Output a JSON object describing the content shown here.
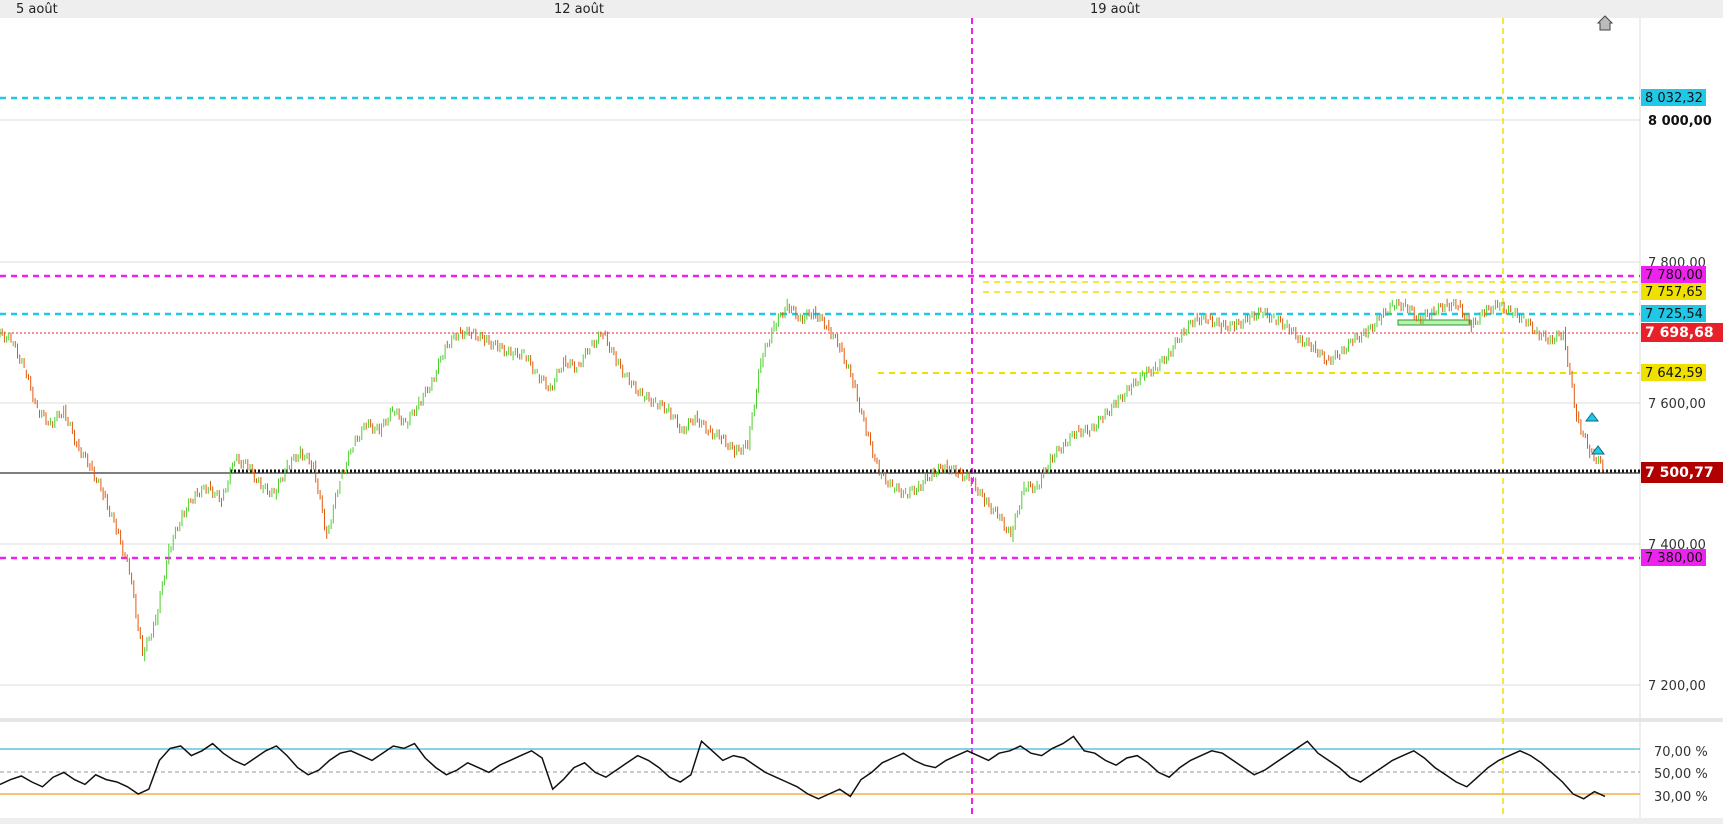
{
  "chart_data": [
    {
      "type": "line",
      "subtype": "candlestick-price",
      "x_labels": [
        "5 août",
        "12 août",
        "19 août"
      ],
      "y_ticks": [
        "8 000,00",
        "7 800,00",
        "7 600,00",
        "7 400,00",
        "7 200,00"
      ],
      "y_tick_values": [
        8000,
        7800,
        7600,
        7400,
        7200
      ],
      "ylim": [
        7150,
        8150
      ],
      "grid": true,
      "current_price": {
        "value": 7500.77,
        "label": "7 500,77",
        "color": "#b00000"
      },
      "last_close_line": {
        "value": 7698.68,
        "label": "7 698,68",
        "color": "#e8202a"
      },
      "levels": [
        {
          "value": 8032.32,
          "label": "8 032,32",
          "color": "#20c8e8",
          "style": "dashed"
        },
        {
          "value": 7780.0,
          "label": "7 780,00",
          "color": "#ee22ee",
          "style": "dashed"
        },
        {
          "value": 7757.65,
          "label": "7 757,65",
          "color": "#f0e000",
          "style": "dashed"
        },
        {
          "value": 7725.54,
          "label": "7 725,54",
          "color": "#20c8e8",
          "style": "dashed"
        },
        {
          "value": 7642.59,
          "label": "7 642,59",
          "color": "#f0e000",
          "style": "dashed"
        },
        {
          "value": 7380.0,
          "label": "7 380,00",
          "color": "#ee22ee",
          "style": "dashed"
        }
      ],
      "series": [
        {
          "values": [
            7700,
            7690,
            7650,
            7590,
            7570,
            7590,
            7540,
            7510,
            7470,
            7420,
            7360,
            7240,
            7290,
            7390,
            7440,
            7470,
            7480,
            7460,
            7520,
            7510,
            7480,
            7470,
            7510,
            7530,
            7510,
            7410,
            7490,
            7540,
            7570,
            7560,
            7590,
            7570,
            7600,
            7630,
            7680,
            7700,
            7700,
            7690,
            7680,
            7670,
            7670,
            7640,
            7620,
            7660,
            7650,
            7680,
            7700,
            7660,
            7630,
            7610,
            7600,
            7590,
            7560,
            7580,
            7560,
            7550,
            7530,
            7540,
            7660,
            7710,
            7740,
            7720,
            7730,
            7710,
            7680,
            7630,
            7560,
            7500,
            7480,
            7470,
            7480,
            7500,
            7510,
            7500,
            7490,
            7460,
            7440,
            7410,
            7480,
            7480,
            7520,
            7540,
            7560,
            7560,
            7580,
            7600,
            7620,
            7640,
            7650,
            7670,
            7700,
            7720,
            7720,
            7710,
            7710,
            7720,
            7730,
            7720,
            7710,
            7690,
            7680,
            7660,
            7670,
            7690,
            7700,
            7720,
            7740,
            7740,
            7720,
            7730,
            7740,
            7740,
            7710,
            7730,
            7740,
            7730,
            7720,
            7700,
            7690,
            7700,
            7580,
            7530,
            7510
          ]
        }
      ]
    },
    {
      "type": "line",
      "subtype": "rsi-indicator",
      "y_ticks": [
        "70,00 %",
        "50,00 %",
        "30,00 %"
      ],
      "y_tick_values": [
        70,
        50,
        30
      ],
      "ylim": [
        10,
        90
      ],
      "reference_lines": [
        {
          "value": 70,
          "color": "#40b8d8"
        },
        {
          "value": 50,
          "color": "#999999"
        },
        {
          "value": 30,
          "color": "#f0a020"
        }
      ],
      "series": [
        {
          "values": [
            38,
            42,
            45,
            40,
            36,
            44,
            48,
            42,
            38,
            46,
            42,
            40,
            36,
            30,
            34,
            58,
            68,
            70,
            62,
            66,
            72,
            64,
            58,
            54,
            60,
            66,
            70,
            62,
            52,
            46,
            50,
            58,
            64,
            66,
            62,
            58,
            64,
            70,
            68,
            72,
            60,
            52,
            46,
            50,
            56,
            52,
            48,
            54,
            58,
            62,
            66,
            60,
            34,
            42,
            52,
            56,
            48,
            44,
            50,
            56,
            62,
            58,
            52,
            44,
            40,
            46,
            74,
            66,
            58,
            62,
            60,
            54,
            48,
            44,
            40,
            36,
            30,
            26,
            30,
            34,
            28,
            42,
            48,
            56,
            60,
            64,
            58,
            54,
            52,
            58,
            62,
            66,
            62,
            58,
            64,
            66,
            70,
            64,
            62,
            68,
            72,
            78,
            66,
            64,
            58,
            54,
            60,
            62,
            56,
            48,
            44,
            52,
            58,
            62,
            66,
            64,
            58,
            52,
            46,
            50,
            56,
            62,
            68,
            74,
            64,
            58,
            52,
            44,
            40,
            46,
            52,
            58,
            62,
            66,
            60,
            52,
            46,
            40,
            36,
            44,
            52,
            58,
            62,
            66,
            62,
            56,
            48,
            40,
            30,
            26,
            32,
            28
          ]
        }
      ]
    }
  ],
  "colors": {
    "up_candle": "#4ccf2e",
    "down_candle": "#e05a10",
    "magenta": "#ee22ee",
    "cyan": "#20c8e8",
    "yellow": "#f0e000",
    "rsi_line": "#111111",
    "alert_marker": "#20c8e8"
  },
  "icons": {
    "top_right": "home-icon",
    "markers": "alert-triangle-icon"
  }
}
